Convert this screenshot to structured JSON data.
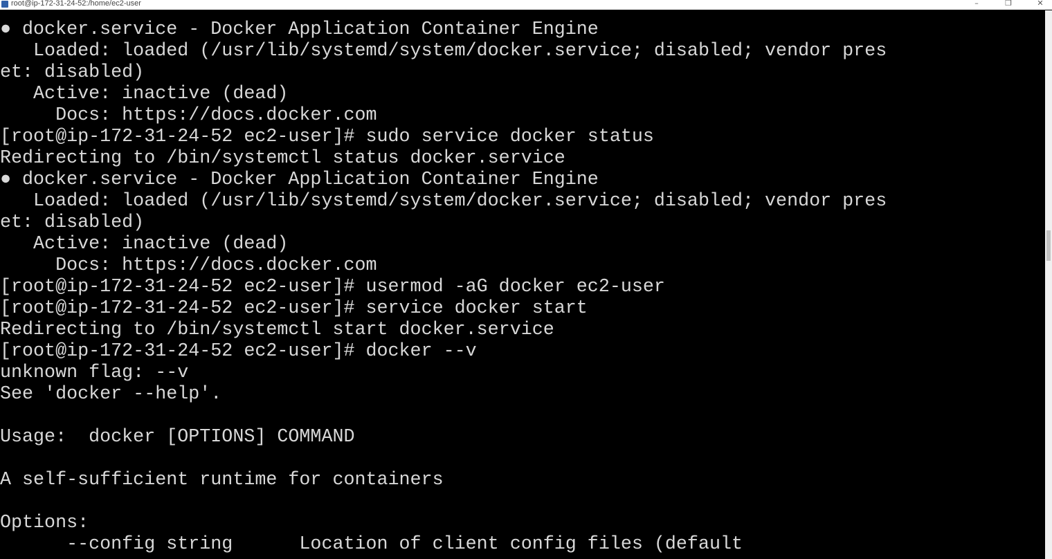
{
  "window": {
    "title": "root@ip-172-31-24-52:/home/ec2-user",
    "minimize_icon": "minimize-icon",
    "maximize_icon": "restore-icon",
    "close_icon": "close-icon",
    "minimize_glyph": "–",
    "maximize_glyph": "❐",
    "close_glyph": "✕"
  },
  "terminal": {
    "lines": [
      "● docker.service - Docker Application Container Engine",
      "   Loaded: loaded (/usr/lib/systemd/system/docker.service; disabled; vendor pres",
      "et: disabled)",
      "   Active: inactive (dead)",
      "     Docs: https://docs.docker.com",
      "[root@ip-172-31-24-52 ec2-user]# sudo service docker status",
      "Redirecting to /bin/systemctl status docker.service",
      "● docker.service - Docker Application Container Engine",
      "   Loaded: loaded (/usr/lib/systemd/system/docker.service; disabled; vendor pres",
      "et: disabled)",
      "   Active: inactive (dead)",
      "     Docs: https://docs.docker.com",
      "[root@ip-172-31-24-52 ec2-user]# usermod -aG docker ec2-user",
      "[root@ip-172-31-24-52 ec2-user]# service docker start",
      "Redirecting to /bin/systemctl start docker.service",
      "[root@ip-172-31-24-52 ec2-user]# docker --v",
      "unknown flag: --v",
      "See 'docker --help'.",
      "",
      "Usage:  docker [OPTIONS] COMMAND",
      "",
      "A self-sufficient runtime for containers",
      "",
      "Options:",
      "      --config string      Location of client config files (default"
    ]
  },
  "colors": {
    "background": "#000000",
    "text": "#d8d8d8"
  }
}
